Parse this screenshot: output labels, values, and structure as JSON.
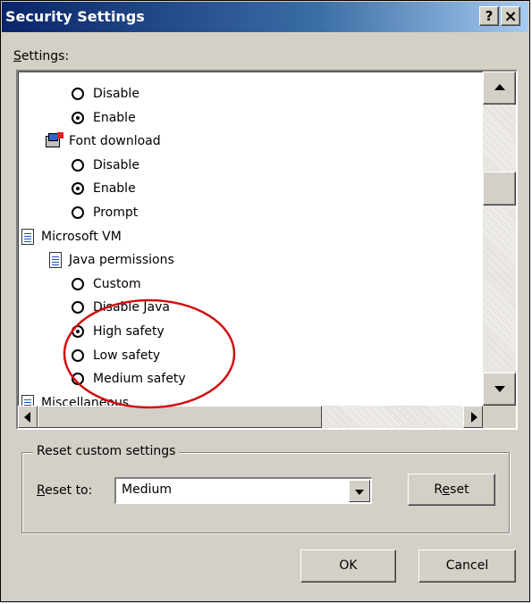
{
  "window": {
    "title": "Security Settings",
    "help_button": "?",
    "close_button": "×"
  },
  "settings_label_prefix": "S",
  "settings_label_rest": "ettings:",
  "tree": [
    {
      "type": "radio",
      "label": "Disable",
      "checked": false,
      "indent": 1
    },
    {
      "type": "radio",
      "label": "Enable",
      "checked": true,
      "indent": 1
    },
    {
      "type": "font-icon",
      "label": "Font download",
      "indent": 0
    },
    {
      "type": "radio",
      "label": "Disable",
      "checked": false,
      "indent": 1
    },
    {
      "type": "radio",
      "label": "Enable",
      "checked": true,
      "indent": 1
    },
    {
      "type": "radio",
      "label": "Prompt",
      "checked": false,
      "indent": 1
    },
    {
      "type": "doc-icon",
      "label": "Microsoft VM",
      "indent": -1
    },
    {
      "type": "doc-icon",
      "label": "Java permissions",
      "indent": 0
    },
    {
      "type": "radio",
      "label": "Custom",
      "checked": false,
      "indent": 1
    },
    {
      "type": "radio",
      "label": "Disable Java",
      "checked": false,
      "indent": 1
    },
    {
      "type": "radio",
      "label": "High safety",
      "checked": true,
      "indent": 1
    },
    {
      "type": "radio",
      "label": "Low safety",
      "checked": false,
      "indent": 1
    },
    {
      "type": "radio",
      "label": "Medium safety",
      "checked": false,
      "indent": 1
    },
    {
      "type": "doc-icon",
      "label": "Miscellaneous",
      "indent": -1
    }
  ],
  "reset_group": {
    "legend": "Reset custom settings",
    "label_prefix": "R",
    "label_rest": "eset to:",
    "selected_value": "Medium",
    "reset_button_pre": "R",
    "reset_button_u": "e",
    "reset_button_post": "set"
  },
  "buttons": {
    "ok": "OK",
    "cancel": "Cancel"
  },
  "colors": {
    "annotation_circle": "#d01010",
    "titlebar": "#0a246a"
  }
}
